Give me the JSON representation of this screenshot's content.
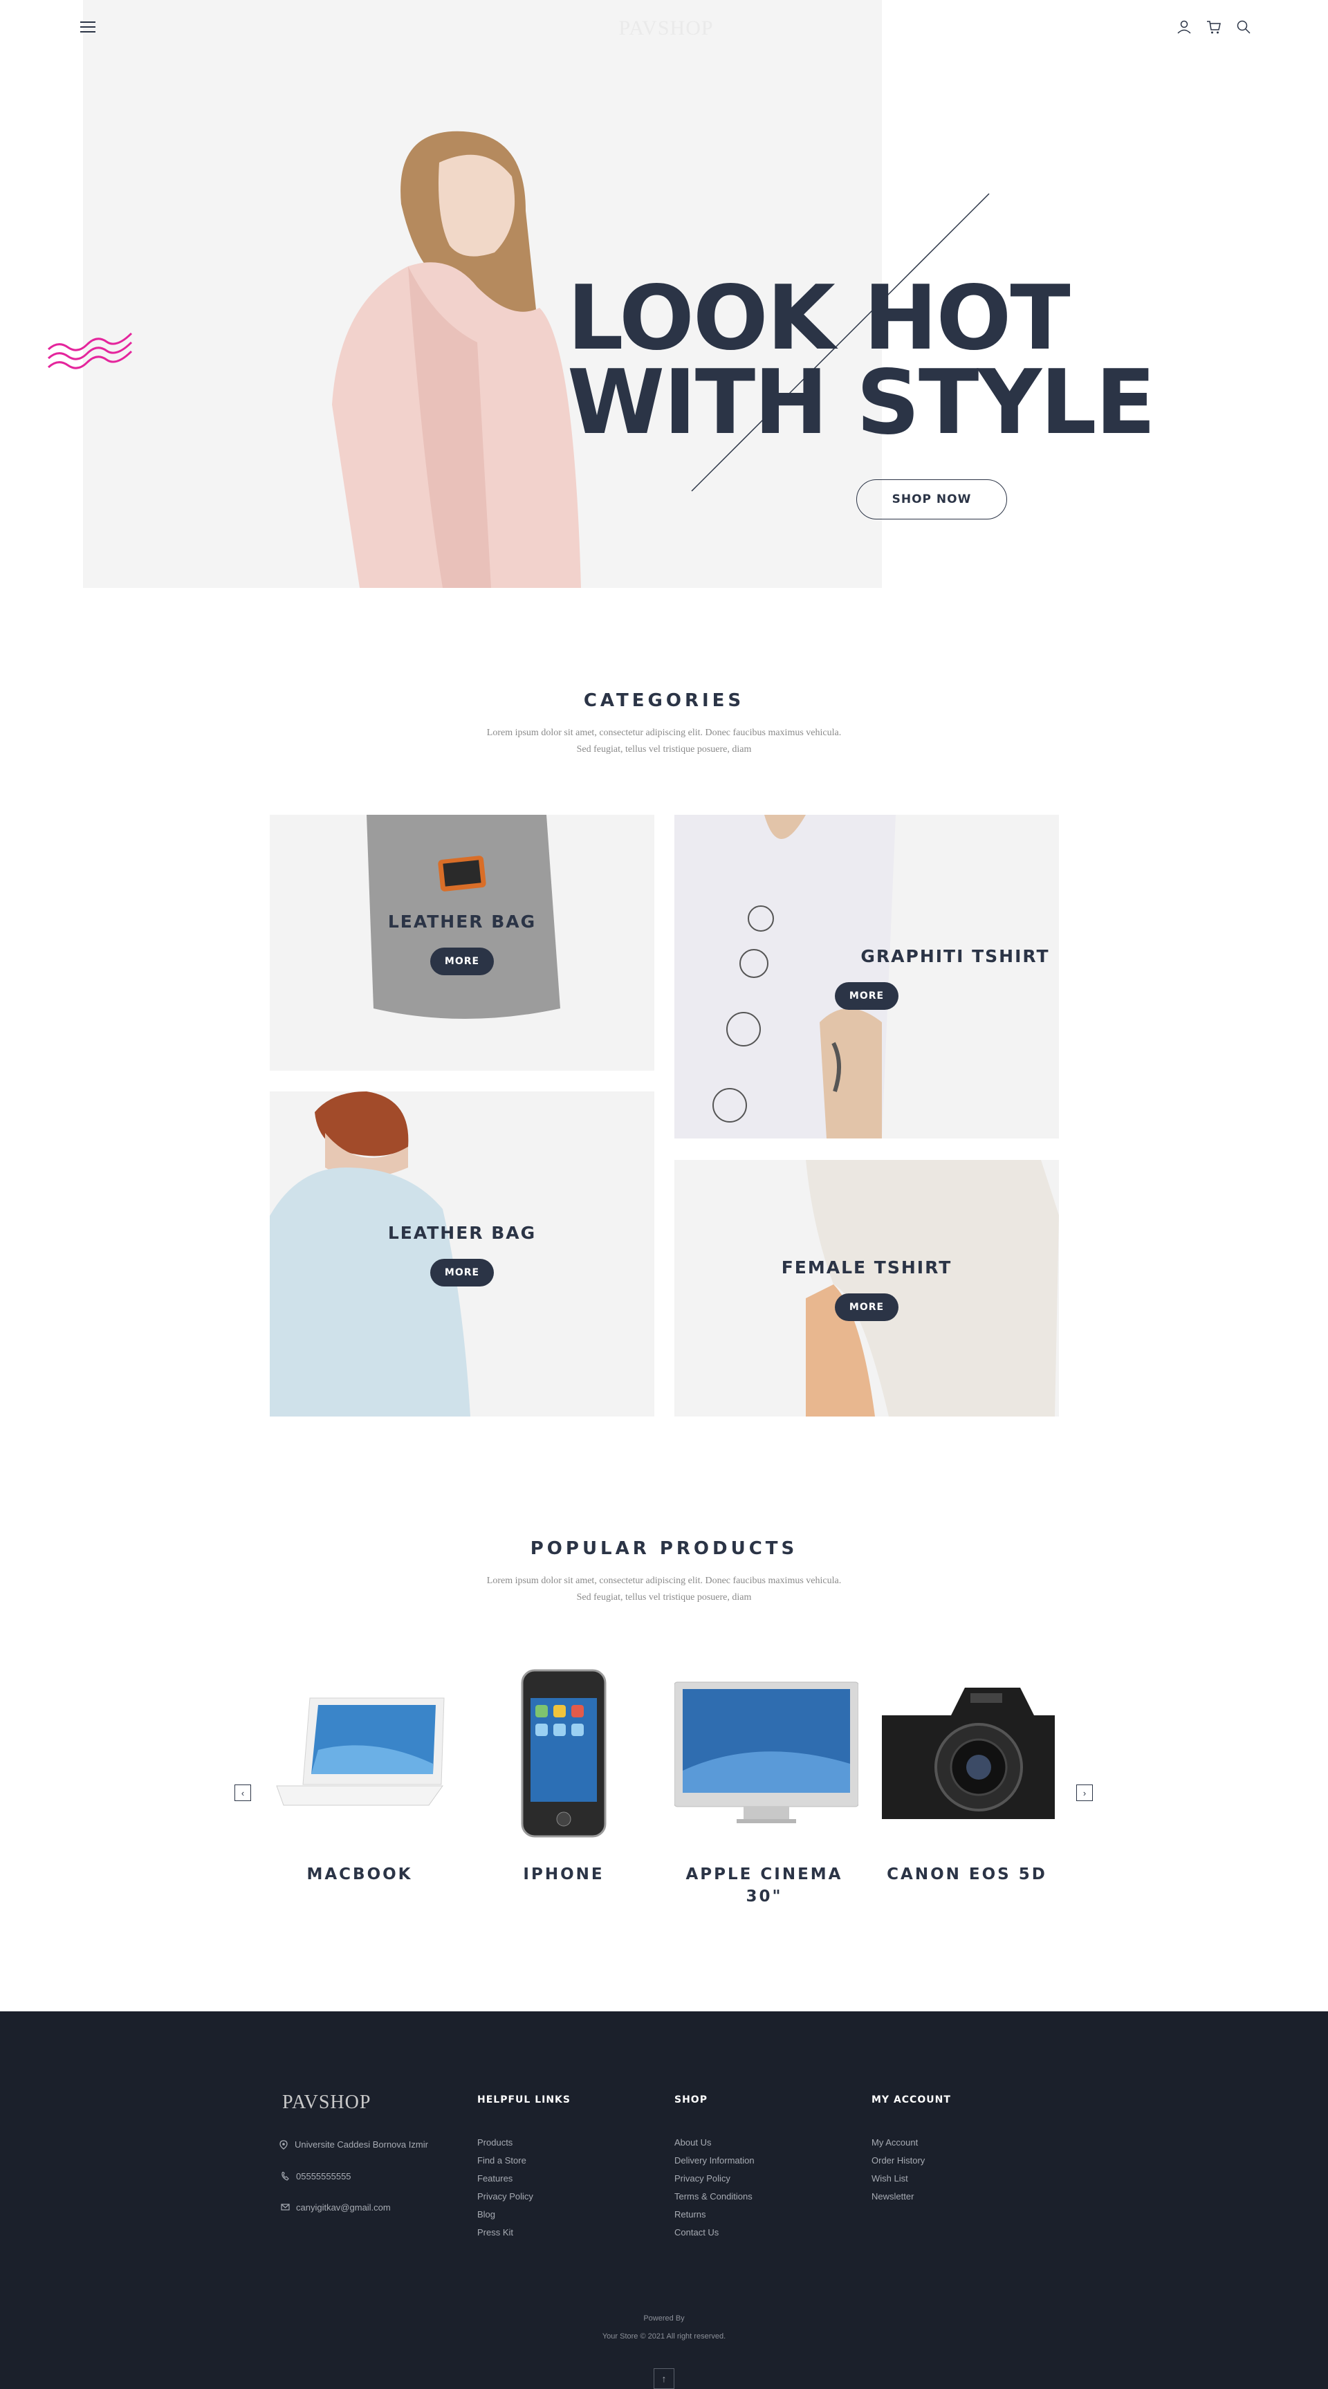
{
  "header": {
    "logo": "PAVSHOP",
    "icons": [
      "menu-icon",
      "user-icon",
      "cart-icon",
      "search-icon"
    ]
  },
  "hero": {
    "title_line1": "LOOK HOT",
    "title_line2": "WITH STYLE",
    "cta_label": "SHOP NOW",
    "accent_color": "#e4259c"
  },
  "categories": {
    "title": "CATEGORIES",
    "subtitle_line1": "Lorem ipsum dolor sit amet, consectetur adipiscing elit. Donec faucibus maximus vehicula.",
    "subtitle_line2": "Sed feugiat, tellus vel tristique posuere, diam",
    "items": [
      {
        "label": "LEATHER BAG",
        "button": "MORE"
      },
      {
        "label": "GRAPHITI TSHIRT",
        "button": "MORE"
      },
      {
        "label": "LEATHER BAG",
        "button": "MORE"
      },
      {
        "label": "FEMALE TSHIRT",
        "button": "MORE"
      }
    ]
  },
  "products": {
    "title": "POPULAR PRODUCTS",
    "subtitle_line1": "Lorem ipsum dolor sit amet, consectetur adipiscing elit. Donec faucibus maximus vehicula.",
    "subtitle_line2": "Sed feugiat, tellus vel tristique posuere, diam",
    "prev_icon": "chevron-left-icon",
    "next_icon": "chevron-right-icon",
    "items": [
      {
        "name": "MACBOOK"
      },
      {
        "name": "IPHONE"
      },
      {
        "name_line1": "APPLE CINEMA",
        "name_line2": "30\""
      },
      {
        "name": "CANON EOS 5D"
      }
    ]
  },
  "footer": {
    "logo": "PAVSHOP",
    "address": "Universite Caddesi Bornova Izmir",
    "phone": "05555555555",
    "email": "canyigitkav@gmail.com",
    "helpful_links": {
      "title": "HELPFUL LINKS",
      "links": [
        "Products",
        "Find a Store",
        "Features",
        "Privacy Policy",
        "Blog",
        "Press Kit"
      ]
    },
    "shop": {
      "title": "SHOP",
      "links": [
        "About Us",
        "Delivery Information",
        "Privacy Policy",
        "Terms & Conditions",
        "Returns",
        "Contact Us"
      ]
    },
    "my_account": {
      "title": "MY ACCOUNT",
      "links": [
        "My Account",
        "Order History",
        "Wish List",
        "Newsletter"
      ]
    },
    "powered_by": "Powered By",
    "copyright": "Your Store © 2021 All right reserved."
  },
  "colors": {
    "primary": "#2b3446",
    "footer_bg": "#1b202b",
    "accent": "#e4259c"
  }
}
